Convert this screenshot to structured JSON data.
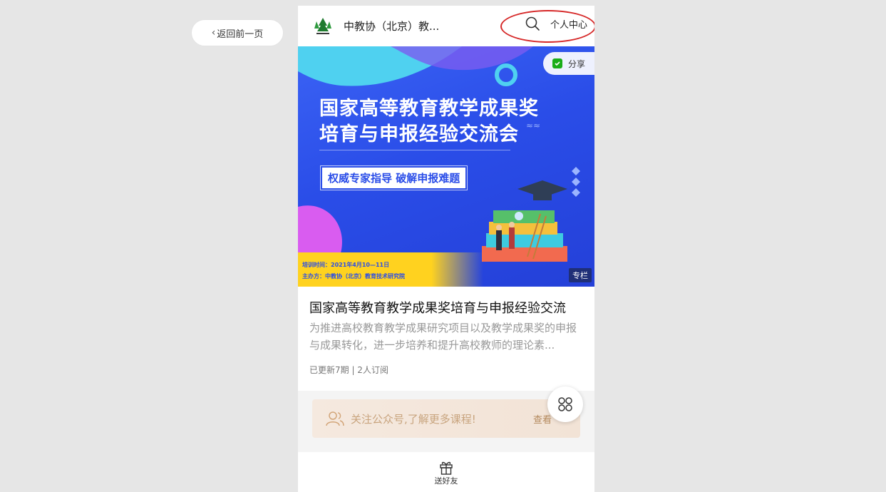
{
  "nav": {
    "back_label": "返回前一页"
  },
  "header": {
    "site_name": "中教协（北京）教...",
    "profile_label": "个人中心"
  },
  "banner": {
    "share_label": "分享",
    "title_line1": "国家高等教育教学成果奖",
    "title_line2": "培育与申报经验交流会",
    "tagline": "权威专家指导 破解申报难题",
    "time_line": "培训时间：2021年4月10—11日",
    "host_line": "主办方：中教协（北京）教育技术研究院",
    "column_badge": "专栏"
  },
  "course": {
    "title": "国家高等教育教学成果奖培育与申报经验交流",
    "description": "为推进高校教育教学成果研究项目以及教学成果奖的申报与成果转化，进一步培养和提升高校教师的理论素...",
    "meta": "已更新7期 | 2人订阅"
  },
  "follow": {
    "text": "关注公众号,了解更多课程!",
    "view_label": "查看"
  },
  "bottom": {
    "gift_label": "送好友"
  },
  "colors": {
    "banner_blue": "#2a4de8",
    "highlight_red": "#d62828",
    "share_green": "#1aad19",
    "follow_text": "#c8a47e"
  },
  "icons": [
    "chevron-left-icon",
    "search-icon",
    "wechat-share-icon",
    "users-icon",
    "grid-menu-icon",
    "gift-icon",
    "logo-tree-icon"
  ]
}
